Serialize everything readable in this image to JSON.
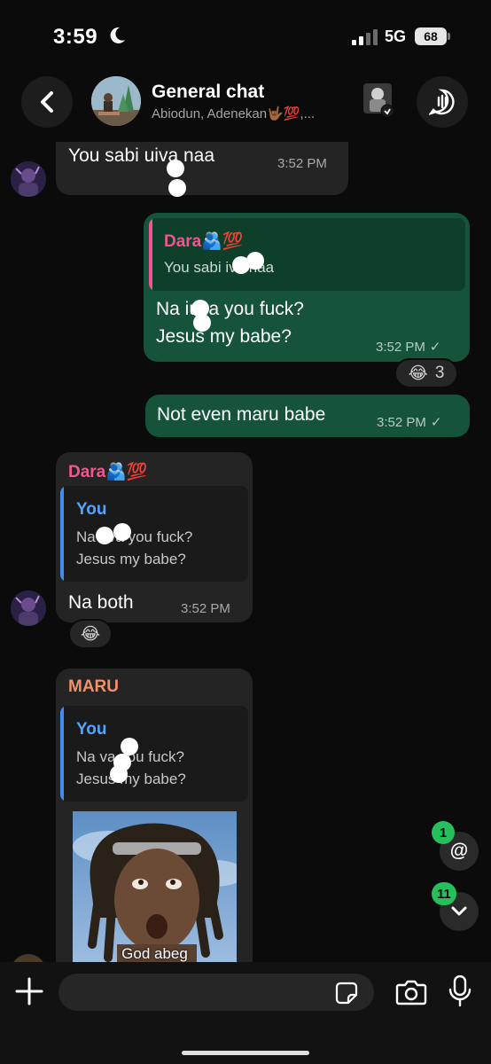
{
  "status_bar": {
    "time": "3:59",
    "network": "5G",
    "battery": "68"
  },
  "header": {
    "title": "General chat",
    "members": "Abiodun, Adenekan🤟🏾💯,..."
  },
  "messages": [
    {
      "id": "m1",
      "direction": "incoming",
      "text": "You sabi   uiva naa",
      "time": "3:52 PM"
    },
    {
      "id": "m2",
      "direction": "outgoing",
      "quote": {
        "author": "Dara🫂💯",
        "text": "You sabi    iva naa"
      },
      "lines": [
        "Na    iuva you fuck?",
        "Jesus my babe?"
      ],
      "time": "3:52 PM",
      "reaction": {
        "emoji": "😂",
        "count": "3"
      }
    },
    {
      "id": "m3",
      "direction": "outgoing",
      "text": "Not even maru  babe",
      "time": "3:52 PM"
    },
    {
      "id": "m4",
      "direction": "incoming",
      "sender": "Dara🫂💯",
      "quote": {
        "author": "You",
        "lines": [
          "Na     uva you fuck?",
          "Jesus my babe?"
        ]
      },
      "text": "Na both",
      "time": "3:52 PM",
      "reaction": {
        "emoji": "😂"
      }
    },
    {
      "id": "m5",
      "direction": "incoming",
      "sender": "MARU",
      "quote": {
        "author": "You",
        "lines": [
          "Na      va you fuck?",
          "Jesus my babe?"
        ]
      },
      "image_caption": "God abeg"
    }
  ],
  "floating": {
    "mentions_badge": "1",
    "mentions_icon": "@",
    "unread_badge": "11"
  },
  "colors": {
    "outgoing_bubble": "#15543a",
    "incoming_bubble": "#242424",
    "accent_pink": "#f0568f",
    "accent_orange": "#f2906a",
    "accent_blue": "#53a3ff",
    "badge_green": "#25c05c"
  },
  "icons": {
    "back": "chevron-left-icon",
    "audio_chat": "voice-chat-icon",
    "plus": "plus-icon",
    "sticker": "sticker-icon",
    "camera": "camera-icon",
    "mic": "microphone-icon",
    "scroll_down": "chevron-down-icon"
  },
  "input": {
    "placeholder": ""
  }
}
